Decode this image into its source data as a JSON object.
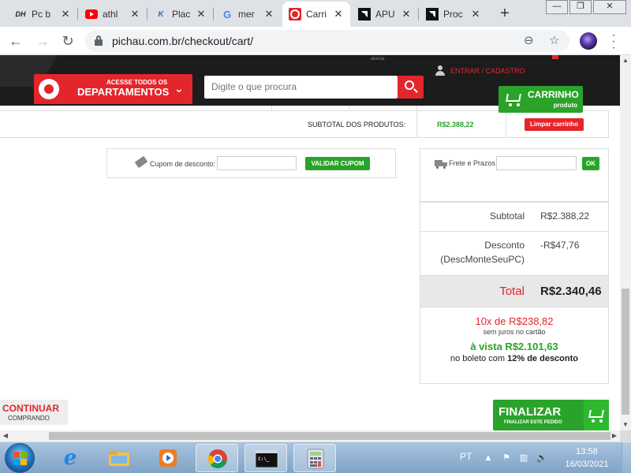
{
  "browser": {
    "tabs": [
      {
        "favicon": "DH",
        "title": "Pc b",
        "active": false
      },
      {
        "favicon": "youtube-icon",
        "title": "athl",
        "active": false
      },
      {
        "favicon": "K",
        "title": "Plac",
        "active": false
      },
      {
        "favicon": "G",
        "title": "mer",
        "active": false
      },
      {
        "favicon": "pichau-icon",
        "title": "Carri",
        "active": true
      },
      {
        "favicon": "amd-icon",
        "title": "APU",
        "active": false
      },
      {
        "favicon": "amd-icon",
        "title": "Proc",
        "active": false
      }
    ],
    "url": "pichau.com.br/checkout/cart/"
  },
  "header": {
    "dept_small": "ACESSE TODOS OS",
    "dept_big": "DEPARTAMENTOS",
    "search_placeholder": "Digite o que procura",
    "login": "ENTRAR / CADASTRO",
    "hidden_tiny": "aluxsa",
    "cart_label": "CARRINHO",
    "cart_sub": "produto"
  },
  "cart": {
    "subtotal_label": "SUBTOTAL DOS PRODUTOS:",
    "subtotal_value": "R$2.388,22",
    "clear_button": "Limpar carrinho"
  },
  "coupon": {
    "label": "Cupom de desconto:",
    "button": "VALIDAR CUPOM"
  },
  "shipping": {
    "label": "Frete e Prazos",
    "button": "OK"
  },
  "summary": {
    "subtotal_label": "Subtotal",
    "subtotal_value": "R$2.388,22",
    "discount_label": "Desconto",
    "discount_code": "(DescMonteSeuPC)",
    "discount_value": "-R$47,76",
    "total_label": "Total",
    "total_value": "R$2.340,46",
    "installments": "10x de R$238,82",
    "installments_note": "sem juros no cartão",
    "cash_price": "à vista R$2.101,63",
    "cash_note_prefix": "no boleto com ",
    "cash_note_bold": "12% de desconto"
  },
  "actions": {
    "continue_main": "CONTINUAR",
    "continue_sub": "COMPRANDO",
    "finish_main": "FINALIZAR",
    "finish_sub": "FINALIZAR ESTE PEDIDO"
  },
  "taskbar": {
    "lang": "PT",
    "time": "13:58",
    "date": "16/03/2021"
  },
  "colors": {
    "brand_red": "#e3262c",
    "success_green": "#29a329",
    "header_dark": "#1c1c1c"
  }
}
